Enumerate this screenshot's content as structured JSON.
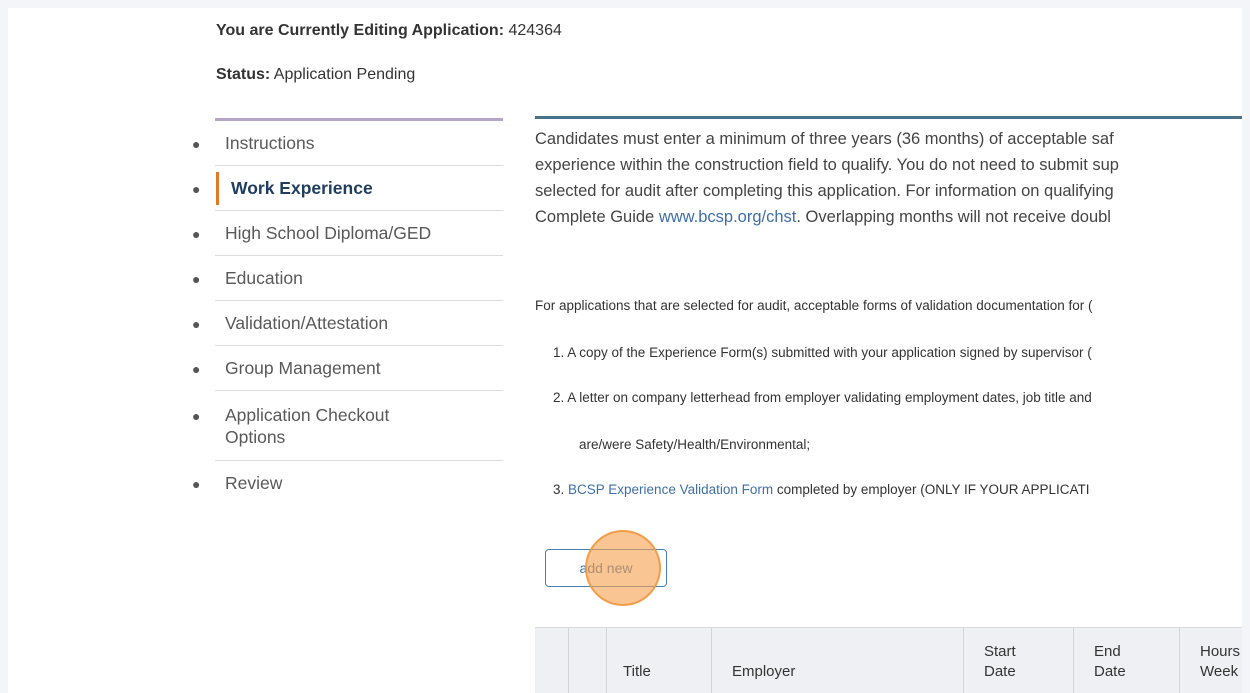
{
  "header": {
    "editing_label": "You are Currently Editing Application:",
    "application_id": "424364",
    "status_label": "Status:",
    "status_value": "Application Pending"
  },
  "sidebar": {
    "items": [
      {
        "label": "Instructions",
        "active": false
      },
      {
        "label": "Work Experience",
        "active": true
      },
      {
        "label": "High School Diploma/GED",
        "active": false
      },
      {
        "label": "Education",
        "active": false
      },
      {
        "label": "Validation/Attestation",
        "active": false
      },
      {
        "label": "Group Management",
        "active": false
      },
      {
        "label": "Application Checkout Options",
        "active": false
      },
      {
        "label": "Review",
        "active": false
      }
    ]
  },
  "main": {
    "intro_line_1": "Candidates must enter a minimum of three years (36 months) of acceptable saf",
    "intro_line_2": "experience within the construction field to qualify. You do not need to submit sup",
    "intro_line_3": "selected for audit after completing this application. For information on qualifying",
    "intro_line_4_pre": "Complete Guide ",
    "intro_link": "www.bcsp.org/chst",
    "intro_line_4_post": ".  Overlapping months will not receive doubl",
    "audit_intro": "For applications that are selected for audit, acceptable forms of validation documentation for (",
    "audit_item_1": "1. A copy of the Experience Form(s) submitted with your application signed by supervisor (",
    "audit_item_2": "2. A letter on company letterhead from employer validating employment dates, job title and",
    "audit_item_2_cont": "are/were Safety/Health/Environmental;",
    "audit_item_3_num": "3. ",
    "audit_item_3_link": "BCSP Experience Validation Form",
    "audit_item_3_post": " completed by employer (ONLY IF YOUR APPLICATI",
    "add_new_label": "add new"
  },
  "table": {
    "headers": {
      "title": "Title",
      "employer": "Employer",
      "start_1": "Start",
      "start_2": "Date",
      "end_1": "End",
      "end_2": "Date",
      "hours_1": "Hours",
      "hours_2": "Week"
    }
  }
}
